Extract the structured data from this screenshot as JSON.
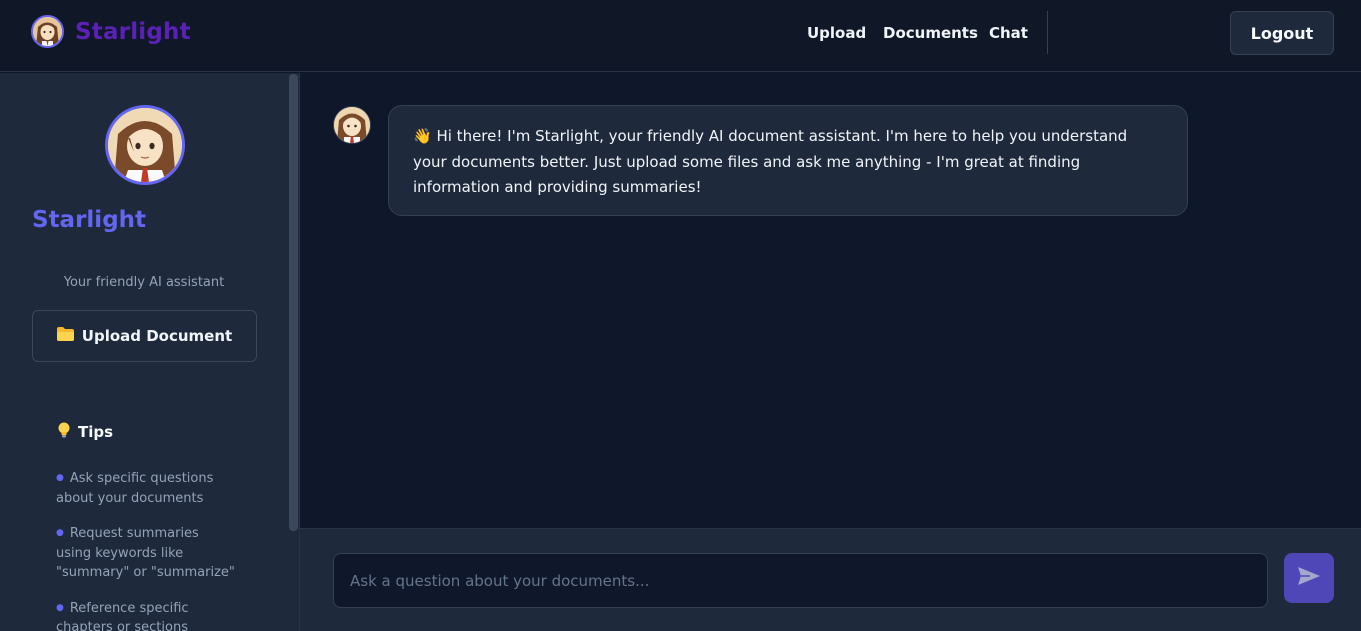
{
  "header": {
    "brand": "Starlight",
    "nav": [
      "Upload",
      "Documents",
      "Chat"
    ],
    "logout_label": "Logout"
  },
  "sidebar": {
    "name": "Starlight",
    "tagline": "Your friendly AI assistant",
    "upload_icon": "folder-icon",
    "upload_label": "Upload Document",
    "tips_icon": "lightbulb-icon",
    "tips_title": "Tips",
    "tips": [
      "Ask specific questions about your documents",
      "Request summaries using keywords like \"summary\" or \"summarize\"",
      "Reference specific chapters or sections"
    ]
  },
  "chat": {
    "messages": [
      {
        "sender": "assistant",
        "emoji": "👋",
        "text": "Hi there! I'm Starlight, your friendly AI document assistant. I'm here to help you understand your documents better. Just upload some files and ask me anything - I'm great at finding information and providing summaries!"
      }
    ],
    "input_placeholder": "Ask a question about your documents...",
    "send_icon": "send-icon"
  },
  "colors": {
    "accent": "#6366f1",
    "brand": "#5b21b6",
    "background": "#0f172a",
    "panel": "#1e293b"
  }
}
